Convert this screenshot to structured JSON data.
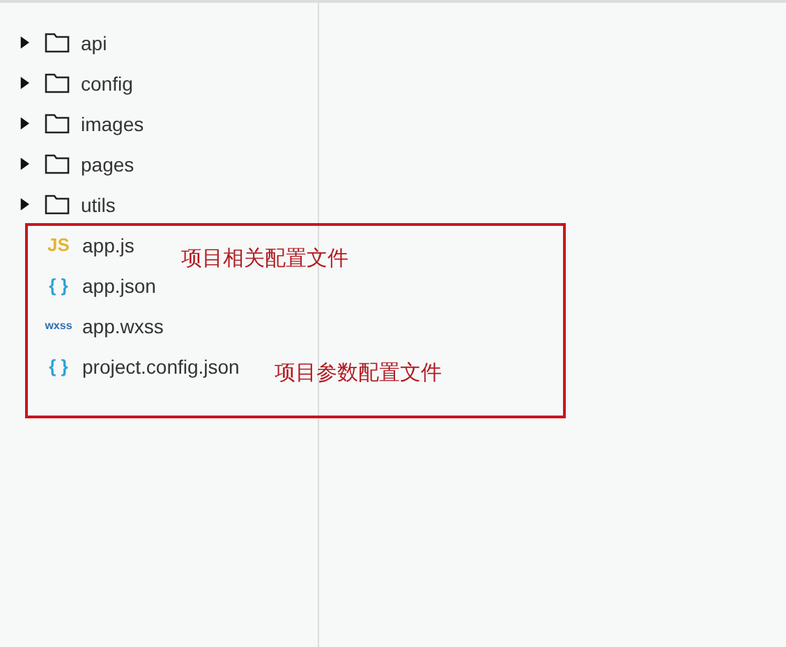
{
  "tree": [
    {
      "kind": "folder",
      "name": "api",
      "expanded": false
    },
    {
      "kind": "folder",
      "name": "config",
      "expanded": false
    },
    {
      "kind": "folder",
      "name": "images",
      "expanded": false
    },
    {
      "kind": "folder",
      "name": "pages",
      "expanded": false
    },
    {
      "kind": "folder",
      "name": "utils",
      "expanded": false
    },
    {
      "kind": "file",
      "name": "app.js",
      "badge": "JS",
      "color": "#e2b534"
    },
    {
      "kind": "file",
      "name": "app.json",
      "badge": "{ }",
      "color": "#2fa3d6"
    },
    {
      "kind": "file",
      "name": "app.wxss",
      "badge": "wxss",
      "color": "#2f6fae"
    },
    {
      "kind": "file",
      "name": "project.config.json",
      "badge": "{ }",
      "color": "#2fa3d6"
    }
  ],
  "annotations": [
    {
      "text": "项目相关配置文件"
    },
    {
      "text": "项目参数配置文件"
    }
  ]
}
